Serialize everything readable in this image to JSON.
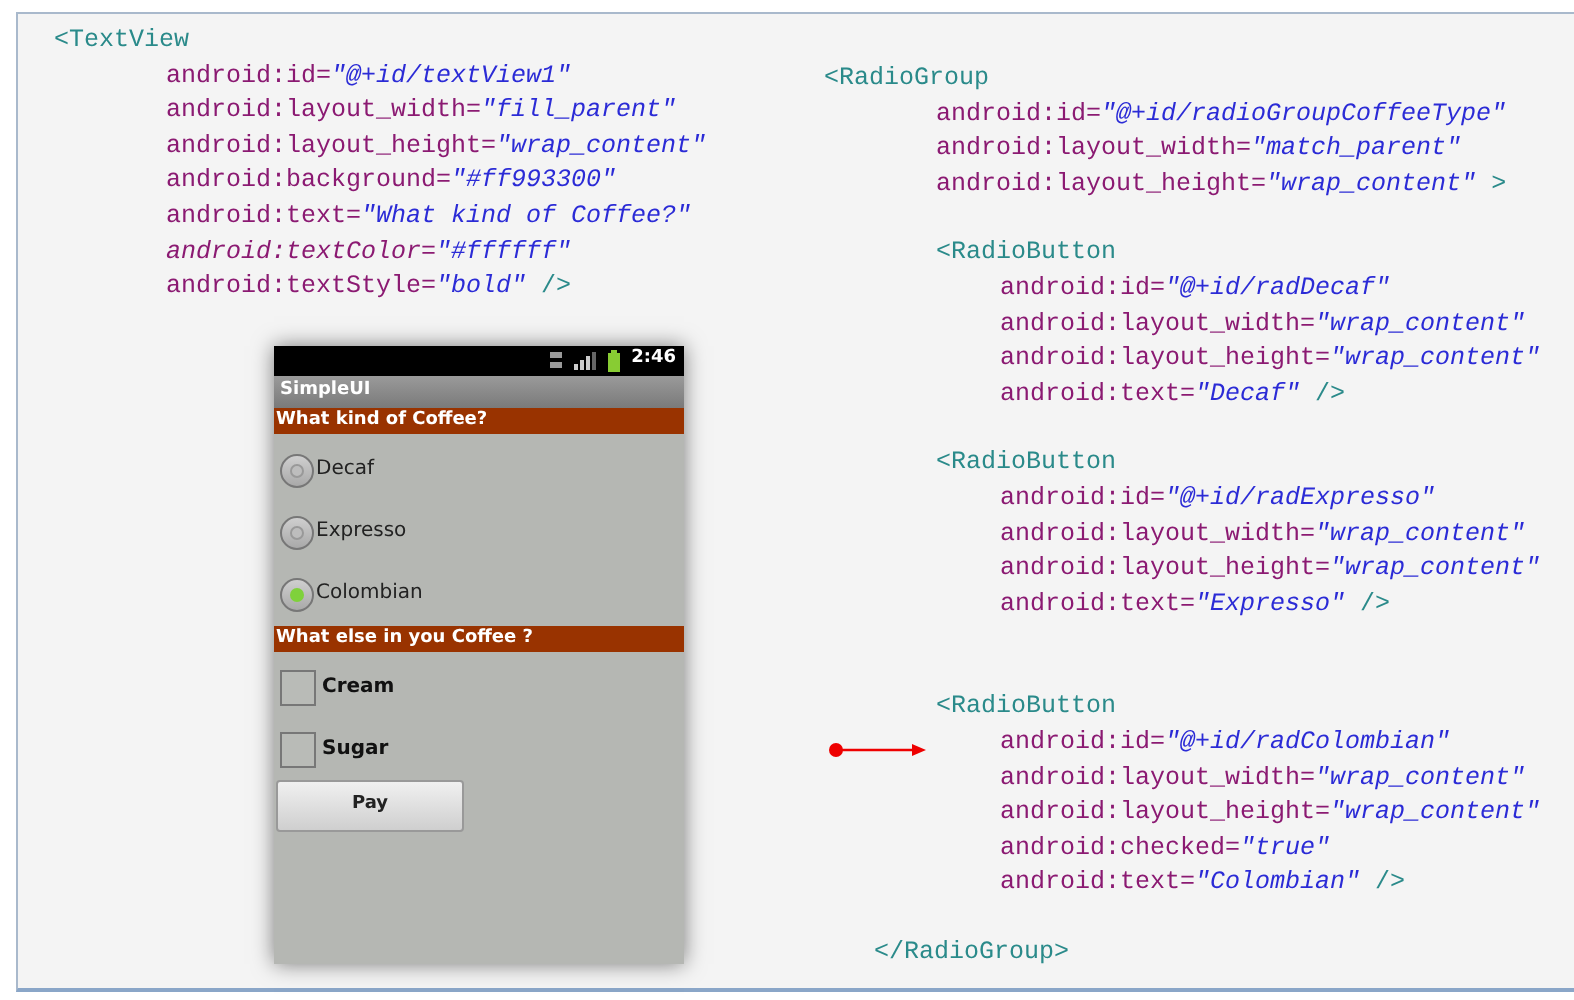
{
  "code_left": {
    "open": "<TextView",
    "attributes": [
      {
        "name": "android:id=",
        "value": "\"@+id/textView1\"",
        "italic": false
      },
      {
        "name": "android:layout_width=",
        "value": "\"fill_parent\"",
        "italic": false
      },
      {
        "name": "android:layout_height=",
        "value": "\"wrap_content\"",
        "italic": false
      },
      {
        "name": "android:background=",
        "value": "\"#ff993300\"",
        "italic": false
      },
      {
        "name": "android:text=",
        "value": "\"What kind of Coffee?\"",
        "italic": false
      },
      {
        "name": "android:textColor=",
        "value": "\"#ffffff\"",
        "italic": true
      },
      {
        "name": "android:textStyle=",
        "value": "\"bold\"",
        "italic": false
      }
    ],
    "end": " />"
  },
  "code_right": {
    "open": "<RadioGroup",
    "attributes": [
      {
        "name": "android:id=",
        "value": "\"@+id/radioGroupCoffeeType\"",
        "italic": false
      },
      {
        "name": "android:layout_width=",
        "value": "\"match_parent\"",
        "italic": false
      },
      {
        "name": "android:layout_height=",
        "value": "\"wrap_content\"",
        "italic": false
      }
    ],
    "end": " >",
    "children": [
      {
        "open": "<RadioButton",
        "attributes": [
          {
            "name": "android:id=",
            "value": "\"@+id/radDecaf\"",
            "italic": false
          },
          {
            "name": "android:layout_width=",
            "value": "\"wrap_content\"",
            "italic": false
          },
          {
            "name": "android:layout_height=",
            "value": "\"wrap_content\"",
            "italic": false
          },
          {
            "name": "android:text=",
            "value": "\"Decaf\"",
            "italic": false
          }
        ],
        "end": " />"
      },
      {
        "open": "<RadioButton",
        "attributes": [
          {
            "name": "android:id=",
            "value": "\"@+id/radExpresso\"",
            "italic": false
          },
          {
            "name": "android:layout_width=",
            "value": "\"wrap_content\"",
            "italic": false
          },
          {
            "name": "android:layout_height=",
            "value": "\"wrap_content\"",
            "italic": false
          },
          {
            "name": "android:text=",
            "value": "\"Expresso\"",
            "italic": false
          }
        ],
        "end": " />"
      },
      {
        "open": "<RadioButton",
        "attributes": [
          {
            "name": "android:id=",
            "value": "\"@+id/radColombian\"",
            "italic": false
          },
          {
            "name": "android:layout_width=",
            "value": "\"wrap_content\"",
            "italic": false
          },
          {
            "name": "android:layout_height=",
            "value": "\"wrap_content\"",
            "italic": false
          },
          {
            "name": "android:checked=",
            "value": "\"true\"",
            "italic": false
          },
          {
            "name": "android:text=",
            "value": "\"Colombian\"",
            "italic": false
          }
        ],
        "end": " />"
      }
    ],
    "close": "</RadioGroup>"
  },
  "phone": {
    "status_time": "2:46",
    "app_title": "SimpleUI",
    "sections": [
      {
        "header": "What kind of Coffee?",
        "items": [
          {
            "kind": "radio",
            "label": "Decaf",
            "selected": false
          },
          {
            "kind": "radio",
            "label": "Expresso",
            "selected": false
          },
          {
            "kind": "radio",
            "label": "Colombian",
            "selected": true
          }
        ]
      },
      {
        "header": "What else in you Coffee ?",
        "items": [
          {
            "kind": "checkbox",
            "label": "Cream",
            "checked": false
          },
          {
            "kind": "checkbox",
            "label": "Sugar",
            "checked": false
          }
        ]
      }
    ],
    "button": "Pay"
  }
}
